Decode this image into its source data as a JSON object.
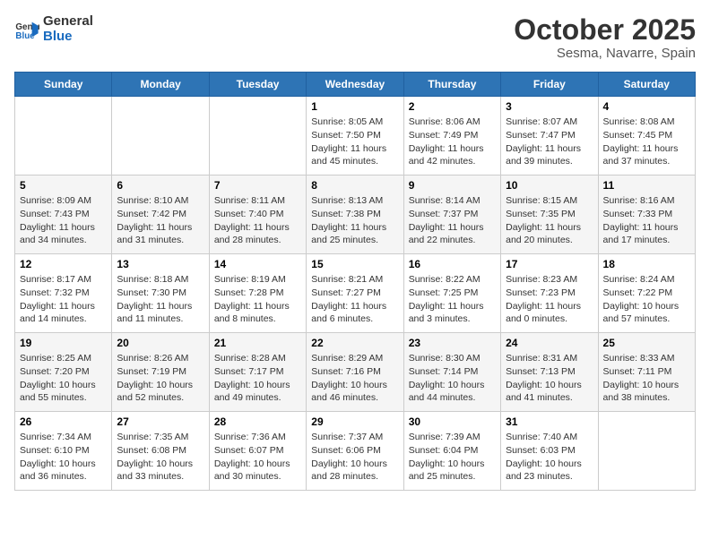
{
  "logo": {
    "line1": "General",
    "line2": "Blue"
  },
  "calendar": {
    "title": "October 2025",
    "subtitle": "Sesma, Navarre, Spain"
  },
  "days_of_week": [
    "Sunday",
    "Monday",
    "Tuesday",
    "Wednesday",
    "Thursday",
    "Friday",
    "Saturday"
  ],
  "weeks": [
    [
      {
        "day": "",
        "info": ""
      },
      {
        "day": "",
        "info": ""
      },
      {
        "day": "",
        "info": ""
      },
      {
        "day": "1",
        "info": "Sunrise: 8:05 AM\nSunset: 7:50 PM\nDaylight: 11 hours and 45 minutes."
      },
      {
        "day": "2",
        "info": "Sunrise: 8:06 AM\nSunset: 7:49 PM\nDaylight: 11 hours and 42 minutes."
      },
      {
        "day": "3",
        "info": "Sunrise: 8:07 AM\nSunset: 7:47 PM\nDaylight: 11 hours and 39 minutes."
      },
      {
        "day": "4",
        "info": "Sunrise: 8:08 AM\nSunset: 7:45 PM\nDaylight: 11 hours and 37 minutes."
      }
    ],
    [
      {
        "day": "5",
        "info": "Sunrise: 8:09 AM\nSunset: 7:43 PM\nDaylight: 11 hours and 34 minutes."
      },
      {
        "day": "6",
        "info": "Sunrise: 8:10 AM\nSunset: 7:42 PM\nDaylight: 11 hours and 31 minutes."
      },
      {
        "day": "7",
        "info": "Sunrise: 8:11 AM\nSunset: 7:40 PM\nDaylight: 11 hours and 28 minutes."
      },
      {
        "day": "8",
        "info": "Sunrise: 8:13 AM\nSunset: 7:38 PM\nDaylight: 11 hours and 25 minutes."
      },
      {
        "day": "9",
        "info": "Sunrise: 8:14 AM\nSunset: 7:37 PM\nDaylight: 11 hours and 22 minutes."
      },
      {
        "day": "10",
        "info": "Sunrise: 8:15 AM\nSunset: 7:35 PM\nDaylight: 11 hours and 20 minutes."
      },
      {
        "day": "11",
        "info": "Sunrise: 8:16 AM\nSunset: 7:33 PM\nDaylight: 11 hours and 17 minutes."
      }
    ],
    [
      {
        "day": "12",
        "info": "Sunrise: 8:17 AM\nSunset: 7:32 PM\nDaylight: 11 hours and 14 minutes."
      },
      {
        "day": "13",
        "info": "Sunrise: 8:18 AM\nSunset: 7:30 PM\nDaylight: 11 hours and 11 minutes."
      },
      {
        "day": "14",
        "info": "Sunrise: 8:19 AM\nSunset: 7:28 PM\nDaylight: 11 hours and 8 minutes."
      },
      {
        "day": "15",
        "info": "Sunrise: 8:21 AM\nSunset: 7:27 PM\nDaylight: 11 hours and 6 minutes."
      },
      {
        "day": "16",
        "info": "Sunrise: 8:22 AM\nSunset: 7:25 PM\nDaylight: 11 hours and 3 minutes."
      },
      {
        "day": "17",
        "info": "Sunrise: 8:23 AM\nSunset: 7:23 PM\nDaylight: 11 hours and 0 minutes."
      },
      {
        "day": "18",
        "info": "Sunrise: 8:24 AM\nSunset: 7:22 PM\nDaylight: 10 hours and 57 minutes."
      }
    ],
    [
      {
        "day": "19",
        "info": "Sunrise: 8:25 AM\nSunset: 7:20 PM\nDaylight: 10 hours and 55 minutes."
      },
      {
        "day": "20",
        "info": "Sunrise: 8:26 AM\nSunset: 7:19 PM\nDaylight: 10 hours and 52 minutes."
      },
      {
        "day": "21",
        "info": "Sunrise: 8:28 AM\nSunset: 7:17 PM\nDaylight: 10 hours and 49 minutes."
      },
      {
        "day": "22",
        "info": "Sunrise: 8:29 AM\nSunset: 7:16 PM\nDaylight: 10 hours and 46 minutes."
      },
      {
        "day": "23",
        "info": "Sunrise: 8:30 AM\nSunset: 7:14 PM\nDaylight: 10 hours and 44 minutes."
      },
      {
        "day": "24",
        "info": "Sunrise: 8:31 AM\nSunset: 7:13 PM\nDaylight: 10 hours and 41 minutes."
      },
      {
        "day": "25",
        "info": "Sunrise: 8:33 AM\nSunset: 7:11 PM\nDaylight: 10 hours and 38 minutes."
      }
    ],
    [
      {
        "day": "26",
        "info": "Sunrise: 7:34 AM\nSunset: 6:10 PM\nDaylight: 10 hours and 36 minutes."
      },
      {
        "day": "27",
        "info": "Sunrise: 7:35 AM\nSunset: 6:08 PM\nDaylight: 10 hours and 33 minutes."
      },
      {
        "day": "28",
        "info": "Sunrise: 7:36 AM\nSunset: 6:07 PM\nDaylight: 10 hours and 30 minutes."
      },
      {
        "day": "29",
        "info": "Sunrise: 7:37 AM\nSunset: 6:06 PM\nDaylight: 10 hours and 28 minutes."
      },
      {
        "day": "30",
        "info": "Sunrise: 7:39 AM\nSunset: 6:04 PM\nDaylight: 10 hours and 25 minutes."
      },
      {
        "day": "31",
        "info": "Sunrise: 7:40 AM\nSunset: 6:03 PM\nDaylight: 10 hours and 23 minutes."
      },
      {
        "day": "",
        "info": ""
      }
    ]
  ]
}
